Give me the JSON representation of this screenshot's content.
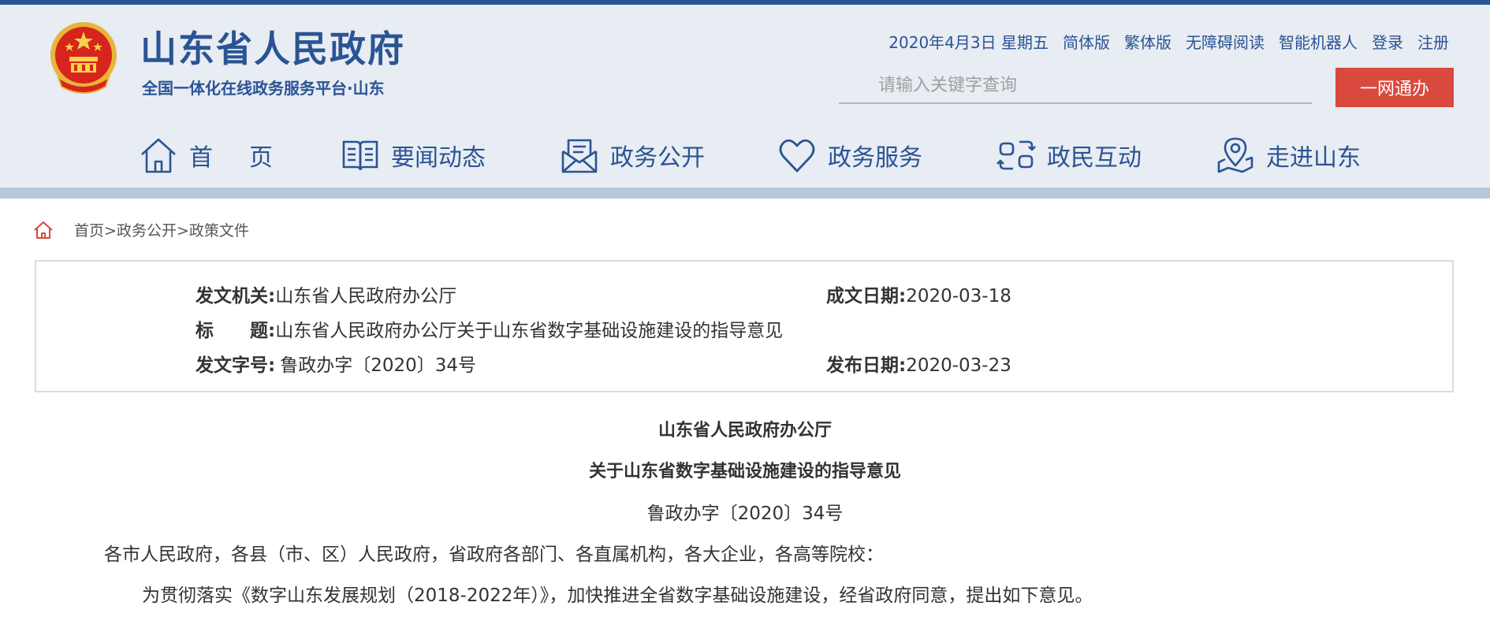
{
  "header": {
    "title": "山东省人民政府",
    "subtitle": "全国一体化在线政务服务平台·山东",
    "date": "2020年4月3日 星期五",
    "links": [
      "简体版",
      "繁体版",
      "无障碍阅读",
      "智能机器人",
      "登录",
      "注册"
    ],
    "search_placeholder": "请输入关键字查询",
    "search_button": "一网通办",
    "brand_color": "#2a5494",
    "accent_color": "#d9493d"
  },
  "nav": {
    "items": [
      {
        "label": "首　页",
        "icon": "home-icon"
      },
      {
        "label": "要闻动态",
        "icon": "book-icon"
      },
      {
        "label": "政务公开",
        "icon": "mail-icon"
      },
      {
        "label": "政务服务",
        "icon": "heart-icon"
      },
      {
        "label": "政民互动",
        "icon": "interaction-icon"
      },
      {
        "label": "走进山东",
        "icon": "map-pin-icon"
      }
    ]
  },
  "breadcrumb": {
    "items": [
      "首页",
      "政务公开",
      "政策文件"
    ],
    "separator": ">"
  },
  "info": {
    "issuer_label": "发文机关:",
    "issuer_value": "山东省人民政府办公厅",
    "written_date_label": "成文日期:",
    "written_date_value": "2020-03-18",
    "title_label": "标　　题:",
    "title_value": "山东省人民政府办公厅关于山东省数字基础设施建设的指导意见",
    "doc_number_label": "发文字号:",
    "doc_number_value": "鲁政办字〔2020〕34号",
    "publish_date_label": "发布日期:",
    "publish_date_value": "2020-03-23"
  },
  "document": {
    "issuer": "山东省人民政府办公厅",
    "title": "关于山东省数字基础设施建设的指导意见",
    "number": "鲁政办字〔2020〕34号",
    "salutation": "各市人民政府，各县（市、区）人民政府，省政府各部门、各直属机构，各大企业，各高等院校：",
    "paragraph1": "为贯彻落实《数字山东发展规划（2018-2022年）》，加快推进全省数字基础设施建设，经省政府同意，提出如下意见。"
  }
}
